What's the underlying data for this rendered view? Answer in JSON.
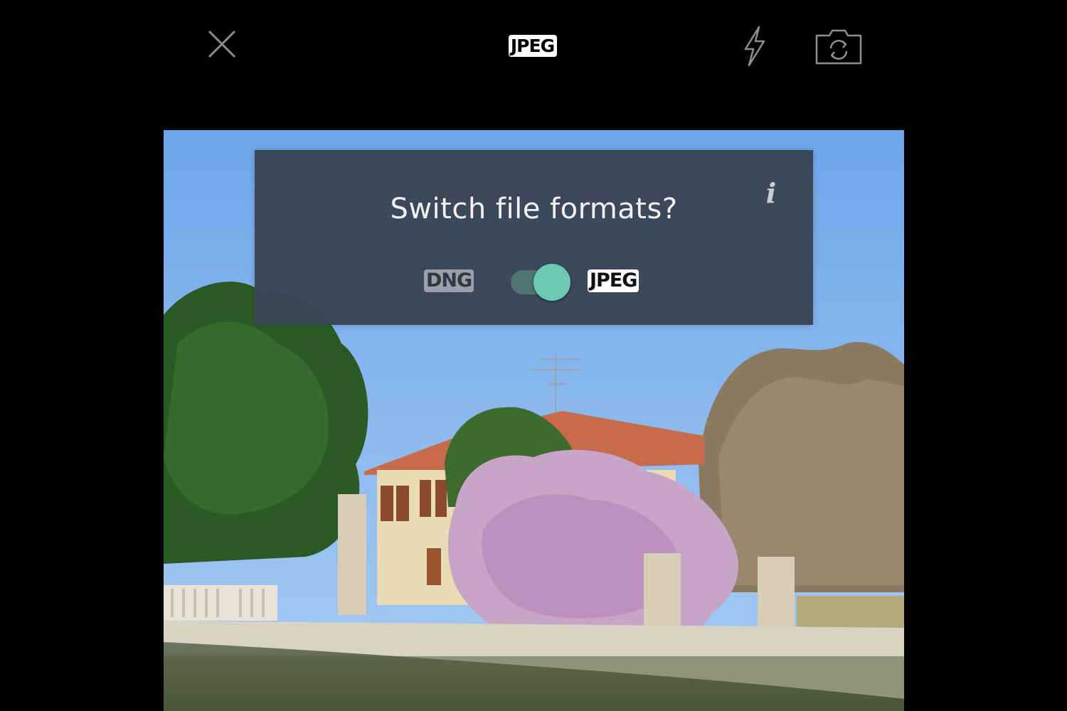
{
  "toolbar": {
    "close_icon": "close-icon",
    "format_badge": "JPEG",
    "flash_icon": "flash-icon",
    "flip_icon": "camera-flip-icon"
  },
  "dialog": {
    "title": "Switch file formats?",
    "info_label": "i",
    "option_left": "DNG",
    "option_right": "JPEG",
    "toggle_state": "JPEG"
  },
  "colors": {
    "background": "#000000",
    "dialog_bg": "#3a4555",
    "toggle_accent": "#6dc9b4",
    "sky": "#7fb1ee"
  }
}
